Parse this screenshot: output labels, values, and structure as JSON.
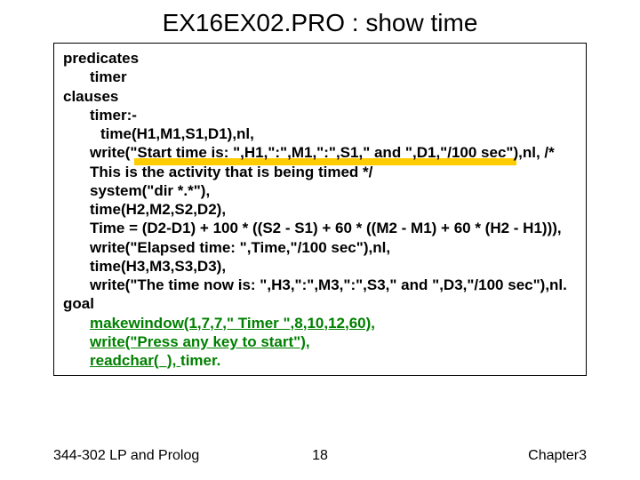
{
  "title": "EX16EX02.PRO : show time",
  "code": {
    "l01": "predicates",
    "l02": "timer",
    "l03": "clauses",
    "l04": "timer:-",
    "l05": "time(H1,M1,S1,D1),nl,",
    "l06": "write(\"Start time is: \",H1,\":\",M1,\":\",S1,\" and \",D1,\"/100 sec\"),nl,   /* This is the activity that is being timed */",
    "l07": "system(\"dir *.*\"),",
    "l08": "time(H2,M2,S2,D2),",
    "l09": "Time = (D2-D1) + 100 * ((S2 - S1) + 60 * ((M2 - M1) + 60 * (H2 - H1))),",
    "l10": "write(\"Elapsed time:  \",Time,\"/100 sec\"),nl,",
    "l11": "time(H3,M3,S3,D3),",
    "l12": "write(\"The time now is: \",H3,\":\",M3,\":\",S3,\" and \",D3,\"/100 sec\"),nl.",
    "l13": "goal",
    "l14": "makewindow(1,7,7,\" Timer \",8,10,12,60),",
    "l15": "write(\"Press any key to start\"),",
    "l16": "readchar(_), ",
    "l16b": "timer."
  },
  "footer": {
    "left": "344-302 LP and Prolog",
    "page": "18",
    "right": "Chapter3"
  }
}
